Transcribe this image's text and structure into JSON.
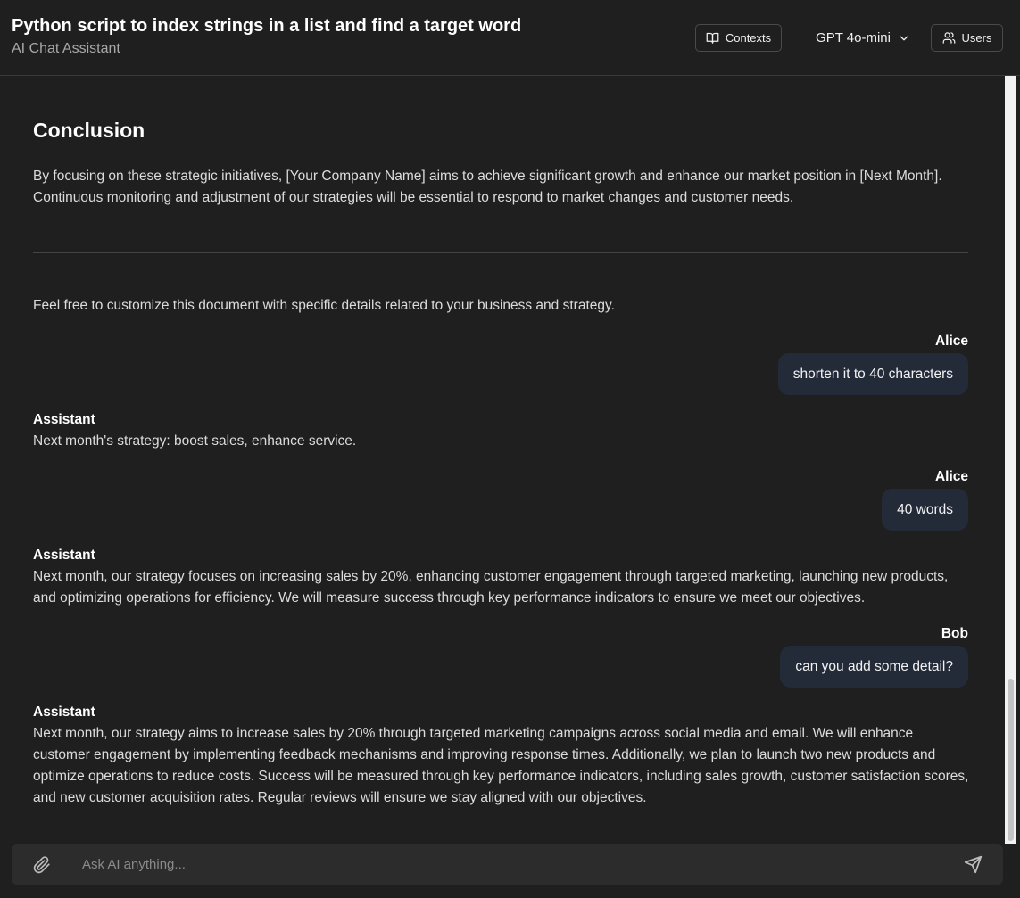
{
  "header": {
    "title": "Python script to index strings in a list and find a target word",
    "subtitle": "AI Chat Assistant",
    "contexts_label": "Contexts",
    "model_label": "GPT 4o-mini",
    "users_label": "Users"
  },
  "content": {
    "conclusion_heading": "Conclusion",
    "conclusion_text": "By focusing on these strategic initiatives, [Your Company Name] aims to achieve significant growth and enhance our market position in [Next Month]. Continuous monitoring and adjustment of our strategies will be essential to respond to market changes and customer needs.",
    "customize_text": "Feel free to customize this document with specific details related to your business and strategy."
  },
  "messages": [
    {
      "sender": "Alice",
      "text": "shorten it to 40 characters",
      "side": "right"
    },
    {
      "sender": "Assistant",
      "text": "Next month's strategy: boost sales, enhance service.",
      "side": "left"
    },
    {
      "sender": "Alice",
      "text": "40 words",
      "side": "right"
    },
    {
      "sender": "Assistant",
      "text": "Next month, our strategy focuses on increasing sales by 20%, enhancing customer engagement through targeted marketing, launching new products, and optimizing operations for efficiency. We will measure success through key performance indicators to ensure we meet our objectives.",
      "side": "left"
    },
    {
      "sender": "Bob",
      "text": "can you add some detail?",
      "side": "right"
    },
    {
      "sender": "Assistant",
      "text": "Next month, our strategy aims to increase sales by 20% through targeted marketing campaigns across social media and email. We will enhance customer engagement by implementing feedback mechanisms and improving response times. Additionally, we plan to launch two new products and optimize operations to reduce costs. Success will be measured through key performance indicators, including sales growth, customer satisfaction scores, and new customer acquisition rates. Regular reviews will ensure we stay aligned with our objectives.",
      "side": "left"
    }
  ],
  "input": {
    "placeholder": "Ask AI anything...",
    "value": ""
  },
  "icons": {
    "contexts": "book-open-icon",
    "model": "chevron-down-icon",
    "users": "users-icon",
    "attach": "paperclip-icon",
    "send": "send-icon"
  },
  "colors": {
    "background": "#1f1f1f",
    "bubble": "#232a38",
    "input_bar": "#2c2c2c"
  }
}
